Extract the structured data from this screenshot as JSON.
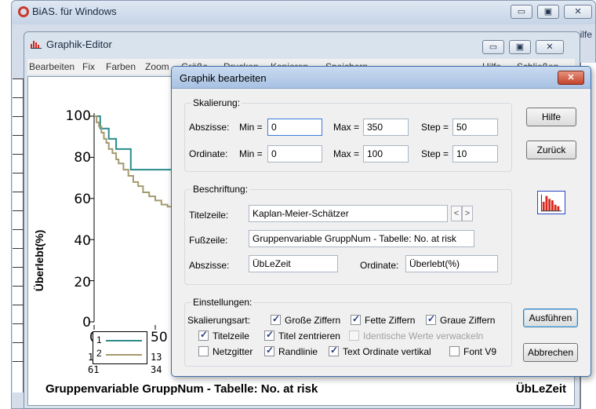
{
  "bias_window": {
    "title": "BiAS. für Windows",
    "menu_right": "ilfe",
    "btn_min": "▭",
    "btn_max": "▣",
    "btn_close": "✕"
  },
  "graphik_editor": {
    "title": "Graphik-Editor",
    "menu": [
      "Bearbeiten",
      "Fix",
      "Farben",
      "Zoom",
      "Größe",
      "Drucken",
      "Kopieren",
      "Speichern",
      "Hilfe",
      "Schließen"
    ],
    "btn_min": "▭",
    "btn_max": "▣",
    "btn_close": "✕"
  },
  "chart": {
    "y_title": "Überlebt(%)",
    "y_ticks": [
      "100",
      "80",
      "60",
      "40",
      "20",
      "0"
    ],
    "x_ticks": [
      "0",
      "50"
    ],
    "risk_row1": [
      "19",
      "13"
    ],
    "risk_row2": [
      "61",
      "34"
    ],
    "legend": [
      "1",
      "2"
    ],
    "footer": "Gruppenvariable GruppNum  -  Tabelle: No. at risk",
    "footer_right": "ÜbLeZeit",
    "colors": {
      "series1": "#2a8c8c",
      "series2": "#a49a6e"
    }
  },
  "chart_data": {
    "type": "line",
    "ylim": [
      0,
      100
    ],
    "ylabel": "Überlebt(%)",
    "xlabel": "ÜbLeZeit",
    "series": [
      {
        "name": "1",
        "x": [
          0,
          3,
          5,
          8,
          12,
          18,
          25,
          30,
          40,
          50,
          60
        ],
        "y": [
          100,
          100,
          94,
          94,
          89,
          84,
          84,
          74,
          74,
          74,
          74
        ]
      },
      {
        "name": "2",
        "x": [
          0,
          2,
          4,
          6,
          8,
          10,
          12,
          15,
          18,
          20,
          24,
          28,
          32,
          36,
          40,
          45,
          50,
          55,
          60
        ],
        "y": [
          100,
          97,
          95,
          92,
          89,
          87,
          84,
          82,
          79,
          77,
          74,
          71,
          68,
          66,
          63,
          61,
          59,
          57,
          56
        ]
      }
    ]
  },
  "dialog": {
    "title": "Graphik bearbeiten",
    "close": "✕",
    "skalierung": {
      "label": "Skalierung:",
      "abszisse_label": "Abszisse:",
      "ordinate_label": "Ordinate:",
      "min_label": "Min =",
      "max_label": "Max =",
      "step_label": "Step =",
      "abs_min": "0",
      "abs_max": "350",
      "abs_step": "50",
      "ord_min": "0",
      "ord_max": "100",
      "ord_step": "10"
    },
    "beschriftung": {
      "label": "Beschriftung:",
      "titel_label": "Titelzeile:",
      "titel_value": "Kaplan-Meier-Schätzer",
      "fuss_label": "Fußzeile:",
      "fuss_value": "Gruppenvariable GruppNum  -  Tabelle: No. at risk",
      "abs_label": "Abszisse:",
      "abs_value": "ÜbLeZeit",
      "ord_label": "Ordinate:",
      "ord_value": "Überlebt(%)"
    },
    "einstellungen": {
      "label": "Einstellungen:",
      "skalierungsart": "Skalierungsart:",
      "grosse_ziffern": "Große Ziffern",
      "fette_ziffern": "Fette Ziffern",
      "graue_ziffern": "Graue Ziffern",
      "titelzeile": "Titelzeile",
      "titel_zentrieren": "Titel zentrieren",
      "identische_werte": "Identische Werte verwackeln",
      "netzgitter": "Netzgitter",
      "randlinie": "Randlinie",
      "text_ordinate": "Text Ordinate vertikal",
      "font_v9": "Font V9"
    },
    "buttons": {
      "hilfe": "Hilfe",
      "zurueck": "Zurück",
      "ausfuehren": "Ausführen",
      "abbrechen": "Abbrechen"
    },
    "spin_prev": "<",
    "spin_next": ">"
  }
}
